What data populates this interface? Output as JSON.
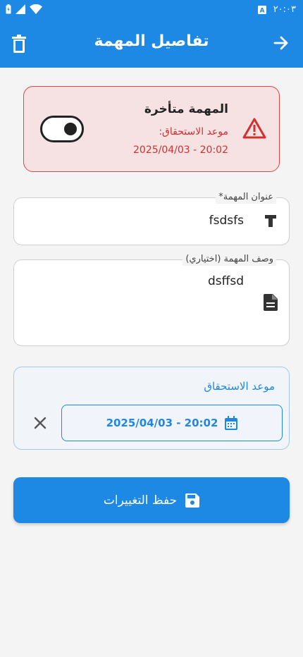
{
  "status_bar": {
    "time": "٢٠:٠٣"
  },
  "app_bar": {
    "title": "تفاصيل المهمة"
  },
  "overdue": {
    "title": "المهمة متأخرة",
    "due_label": "موعد الاستحقاق:",
    "due_value": "2025/04/03 - 20:02",
    "toggle_on": true
  },
  "task_title": {
    "label": "عنوان المهمة*",
    "value": "fsdsfs"
  },
  "task_description": {
    "label": "وصف المهمة (اختياري)",
    "value": "dsffsd"
  },
  "due": {
    "label": "موعد الاستحقاق",
    "value": "2025/04/03 - 20:02"
  },
  "save_button": {
    "label": "حفظ التغييرات"
  },
  "colors": {
    "primary": "#1e88e5",
    "danger": "#d32f2f",
    "danger_bg": "#f6e2e2"
  }
}
